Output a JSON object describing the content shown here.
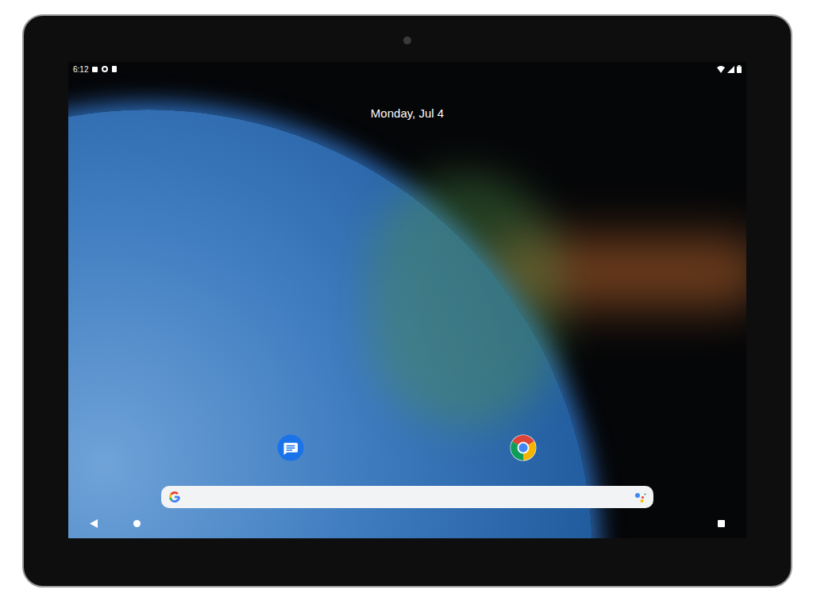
{
  "status_bar": {
    "time": "6:12"
  },
  "date": "Monday, Jul 4"
}
